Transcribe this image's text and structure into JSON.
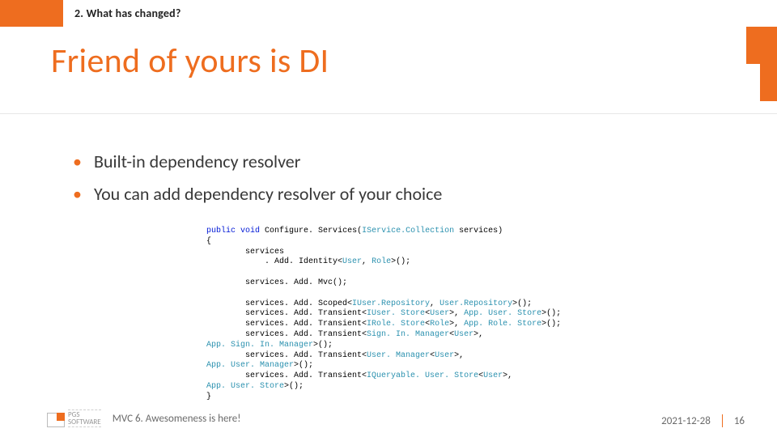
{
  "header": {
    "section_label": "2. What has changed?"
  },
  "title": "Friend of yours is DI",
  "bullets": [
    "Built-in dependency resolver",
    "You can add dependency resolver of your choice"
  ],
  "code": {
    "l1_kw1": "public",
    "l1_kw2": "void",
    "l1_m": " Configure. Services(",
    "l1_tp": "IService.Collection",
    "l1_rest": " services)",
    "l2": "{",
    "l3": "        services",
    "l4a": "            . Add. Identity<",
    "l4_tp1": "User",
    "l4b": ", ",
    "l4_tp2": "Role",
    "l4c": ">();",
    "l5": "",
    "l6": "        services. Add. Mvc();",
    "l7": "",
    "l8a": "        services. Add. Scoped<",
    "l8_tp1": "IUser.Repository",
    "l8b": ", ",
    "l8_tp2": "User.Repository",
    "l8c": ">();",
    "l9a": "        services. Add. Transient<",
    "l9_tp1": "IUser. Store",
    "l9b": "<",
    "l9_tp2": "User",
    "l9c": ">, ",
    "l9_tp3": "App. User. Store",
    "l9d": ">();",
    "l10a": "        services. Add. Transient<",
    "l10_tp1": "IRole. Store",
    "l10b": "<",
    "l10_tp2": "Role",
    "l10c": ">, ",
    "l10_tp3": "App. Role. Store",
    "l10d": ">();",
    "l11a": "        services. Add. Transient<",
    "l11_tp1": "Sign. In. Manager",
    "l11b": "<",
    "l11_tp2": "User",
    "l11c": ">,",
    "l12_tp": "App. Sign. In. Manager",
    "l12b": ">();",
    "l13a": "        services. Add. Transient<",
    "l13_tp1": "User. Manager",
    "l13b": "<",
    "l13_tp2": "User",
    "l13c": ">,",
    "l14_tp": "App. User. Manager",
    "l14b": ">();",
    "l15a": "        services. Add. Transient<",
    "l15_tp1": "IQueryable. User. Store",
    "l15b": "<",
    "l15_tp2": "User",
    "l15c": ">,",
    "l16_tp": "App. User. Store",
    "l16b": ">();",
    "l17": "}"
  },
  "footer": {
    "logo_line1": "PGS",
    "logo_line2": "SOFTWARE",
    "deck_title": "MVC 6. Awesomeness is here!",
    "date": "2021-12-28",
    "page": "16"
  }
}
